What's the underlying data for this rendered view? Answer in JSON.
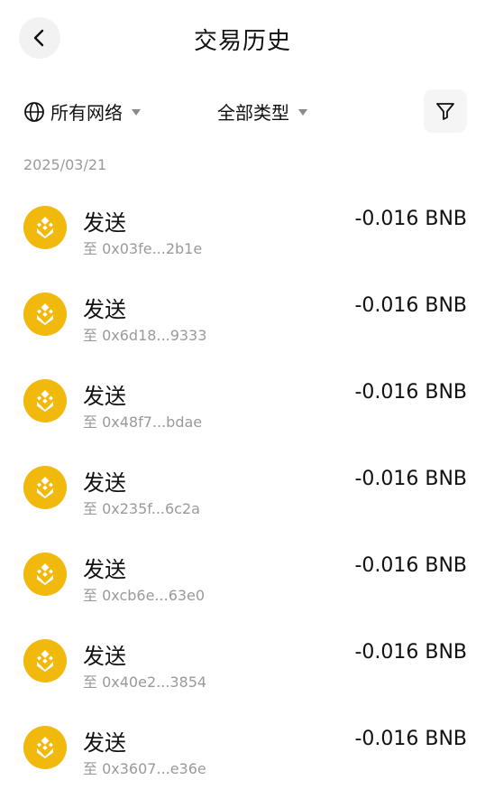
{
  "header": {
    "title": "交易历史"
  },
  "filters": {
    "network_label": "所有网络",
    "type_label": "全部类型"
  },
  "section": {
    "date": "2025/03/21"
  },
  "colors": {
    "bnb": "#f0b90b",
    "secondary_text": "#9a9a9a"
  },
  "transactions": [
    {
      "type": "发送",
      "to": "至 0x03fe...2b1e",
      "amount": "-0.016 BNB",
      "icon": "bnb-coin-icon"
    },
    {
      "type": "发送",
      "to": "至 0x6d18...9333",
      "amount": "-0.016 BNB",
      "icon": "bnb-coin-icon"
    },
    {
      "type": "发送",
      "to": "至 0x48f7...bdae",
      "amount": "-0.016 BNB",
      "icon": "bnb-coin-icon"
    },
    {
      "type": "发送",
      "to": "至 0x235f...6c2a",
      "amount": "-0.016 BNB",
      "icon": "bnb-coin-icon"
    },
    {
      "type": "发送",
      "to": "至 0xcb6e...63e0",
      "amount": "-0.016 BNB",
      "icon": "bnb-coin-icon"
    },
    {
      "type": "发送",
      "to": "至 0x40e2...3854",
      "amount": "-0.016 BNB",
      "icon": "bnb-coin-icon"
    },
    {
      "type": "发送",
      "to": "至 0x3607...e36e",
      "amount": "-0.016 BNB",
      "icon": "bnb-coin-icon"
    }
  ]
}
